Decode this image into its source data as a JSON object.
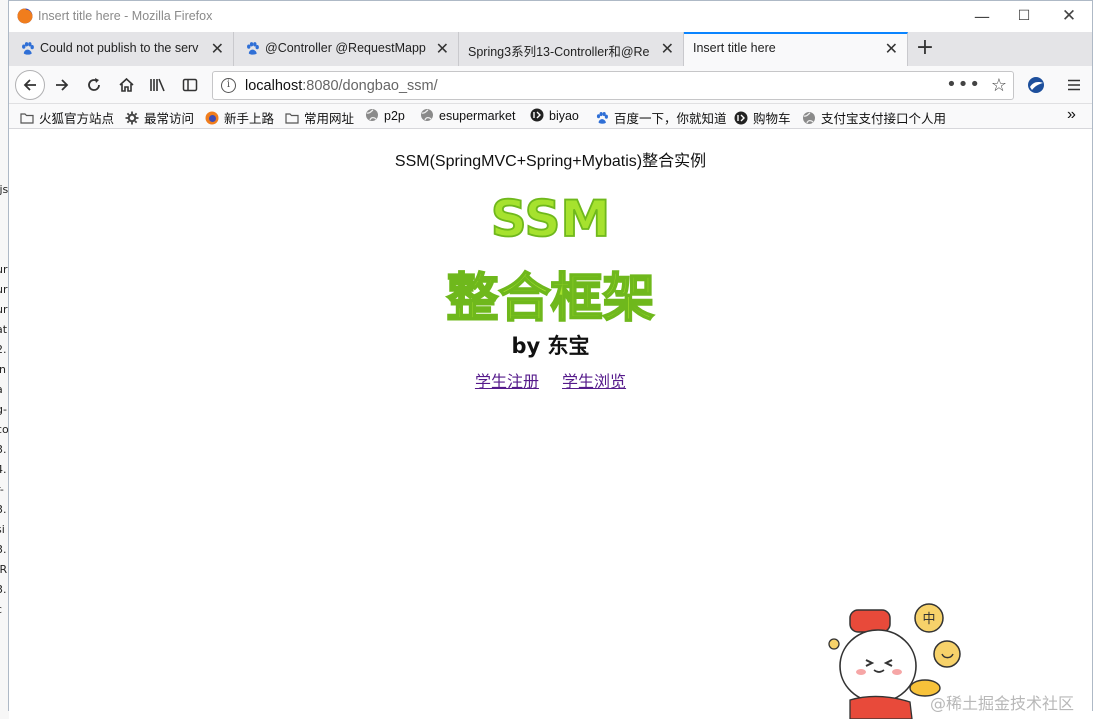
{
  "window": {
    "title": "Insert title here - Mozilla Firefox"
  },
  "tabs": [
    {
      "label": "Could not publish to the serv",
      "icon": "baidu-paw-icon",
      "active": false
    },
    {
      "label": "@Controller @RequestMapp",
      "icon": "baidu-paw-icon",
      "active": false
    },
    {
      "label": "Spring3系列13-Controller和@Re",
      "icon": "",
      "active": false
    },
    {
      "label": "Insert title here",
      "icon": "",
      "active": true
    }
  ],
  "navbar": {
    "url_host": "localhost",
    "url_rest": ":8080/dongbao_ssm/"
  },
  "bookmarks": [
    {
      "label": "火狐官方站点",
      "icon": "folder-icon"
    },
    {
      "label": "最常访问",
      "icon": "gear-icon"
    },
    {
      "label": "新手上路",
      "icon": "firefox-icon"
    },
    {
      "label": "常用网址",
      "icon": "folder-icon"
    },
    {
      "label": "p2p",
      "icon": "globe-icon"
    },
    {
      "label": "esupermarket",
      "icon": "globe-icon"
    },
    {
      "label": "biyao",
      "icon": "biyao-icon"
    },
    {
      "label": "百度一下，你就知道",
      "icon": "baidu-paw-icon"
    },
    {
      "label": "购物车",
      "icon": "biyao-icon"
    },
    {
      "label": "支付宝支付接口个人用",
      "icon": "globe-icon"
    }
  ],
  "page": {
    "heading": "SSM(SpringMVC+Spring+Mybatis)整合实例",
    "big_title_1": "SSM",
    "big_title_2": "整合框架",
    "byline": "by 东宝",
    "link_register": "学生注册",
    "link_browse": "学生浏览"
  },
  "overlay": {
    "watermark": "@稀土掘金技术社区",
    "mascot_badge": "中"
  },
  "colors": {
    "title_fill": "#a6e22e",
    "title_stroke": "#6fb81c",
    "link_visited": "#551a8b",
    "tab_accent": "#0a84ff"
  }
}
